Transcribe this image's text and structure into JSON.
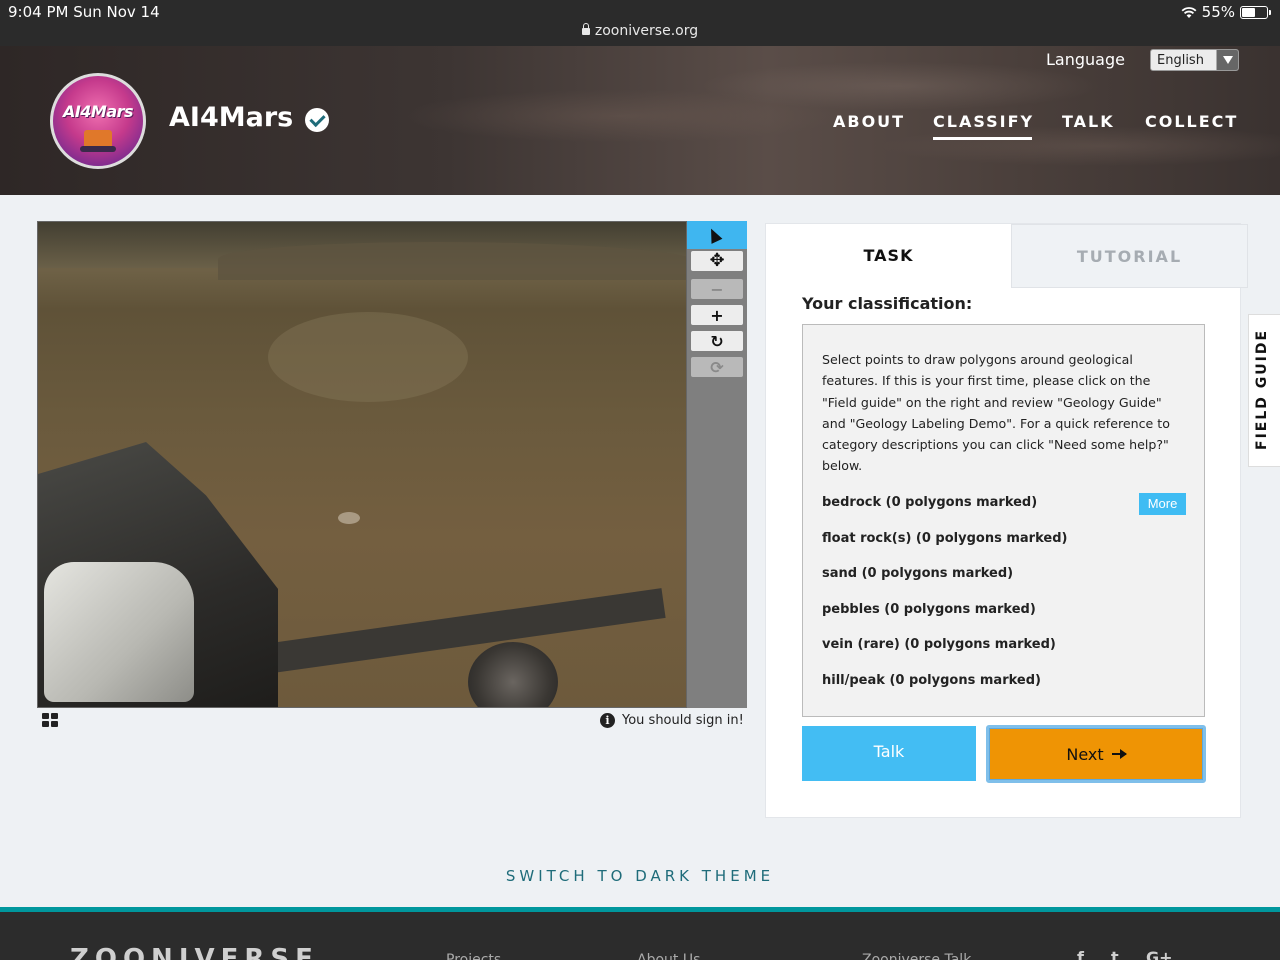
{
  "status_bar": {
    "time": "9:04 PM   Sun Nov 14",
    "url": "zooniverse.org",
    "battery": "55%",
    "battery_level": 0.55
  },
  "header": {
    "logo_text": "AI4Mars",
    "project_title": "AI4Mars",
    "language_label": "Language",
    "language_value": "English",
    "nav": [
      {
        "label": "ABOUT",
        "active": false
      },
      {
        "label": "CLASSIFY",
        "active": true
      },
      {
        "label": "TALK",
        "active": false
      },
      {
        "label": "COLLECT",
        "active": false
      }
    ]
  },
  "viewer": {
    "toolbar_icons": [
      "cursor-icon",
      "move-icon",
      "zoom-out-icon",
      "zoom-in-icon",
      "rotate-icon",
      "reset-icon"
    ],
    "sign_in_note": "You should sign in!"
  },
  "task_panel": {
    "tabs": [
      "TASK",
      "TUTORIAL"
    ],
    "classification_label": "Your classification:",
    "instructions": "Select points to draw polygons around geological features. If this is your first time, please click on the \"Field guide\" on the right and review \"Geology Guide\" and \"Geology Labeling Demo\". For a quick reference to category descriptions you can click \"Need some help?\" below.",
    "answers": [
      "bedrock (0 polygons marked)",
      "float rock(s) (0 polygons marked)",
      "sand (0 polygons marked)",
      "pebbles (0 polygons marked)",
      "vein (rare) (0 polygons marked)",
      "hill/peak (0 polygons marked)"
    ],
    "more_label": "More",
    "talk_label": "Talk",
    "next_label": "Next"
  },
  "field_guide_label": "FIELD GUIDE",
  "theme_switch": "SWITCH TO DARK THEME",
  "footer": {
    "logo": "ZOONIVERSE",
    "links": [
      "Projects",
      "About Us",
      "Zooniverse Talk"
    ],
    "social": [
      "f",
      "t",
      "G+"
    ]
  },
  "colors": {
    "accent_blue": "#3fb6f0",
    "next_orange": "#ef9404",
    "teal": "#1f6c7a",
    "footer_teal": "#00979d"
  }
}
